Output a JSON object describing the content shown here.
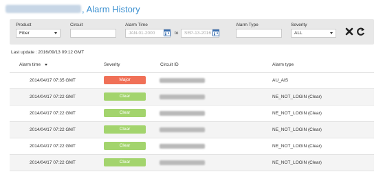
{
  "header": {
    "separator": ",",
    "title": "Alarm History"
  },
  "filters": {
    "product": {
      "label": "Product",
      "value": "Fiber"
    },
    "circuit": {
      "label": "Circuit",
      "value": ""
    },
    "alarm_time": {
      "label": "Alarm Time",
      "from": "JAN-01-2000",
      "to_label": "to",
      "to": "SEP-13-2016"
    },
    "alarm_type": {
      "label": "Alarm Type",
      "value": ""
    },
    "severity": {
      "label": "Severity",
      "value": "ALL"
    }
  },
  "last_update": "Last update : 2016/09/13 09:12 GMT",
  "table": {
    "columns": [
      "Alarm time",
      "Severity",
      "Circuit ID",
      "Alarm type"
    ],
    "rows": [
      {
        "time": "2014/04/17 07:35 GMT",
        "severity": "Major",
        "alarm_type": "AU_AIS"
      },
      {
        "time": "2014/04/17 07:22 GMT",
        "severity": "Clear",
        "alarm_type": "NE_NOT_LOGIN (Clear)"
      },
      {
        "time": "2014/04/17 07:22 GMT",
        "severity": "Clear",
        "alarm_type": "NE_NOT_LOGIN (Clear)"
      },
      {
        "time": "2014/04/17 07:22 GMT",
        "severity": "Clear",
        "alarm_type": "NE_NOT_LOGIN (Clear)"
      },
      {
        "time": "2014/04/17 07:22 GMT",
        "severity": "Clear",
        "alarm_type": "NE_NOT_LOGIN (Clear)"
      },
      {
        "time": "2014/04/17 07:22 GMT",
        "severity": "Clear",
        "alarm_type": "NE_NOT_LOGIN (Clear)"
      }
    ]
  },
  "colors": {
    "accent": "#3a8fd0",
    "major": "#f07057",
    "clear": "#a3d46d"
  },
  "icons": {
    "calendar": "calendar-icon",
    "clear_filters": "close-icon",
    "refresh": "refresh-icon"
  }
}
